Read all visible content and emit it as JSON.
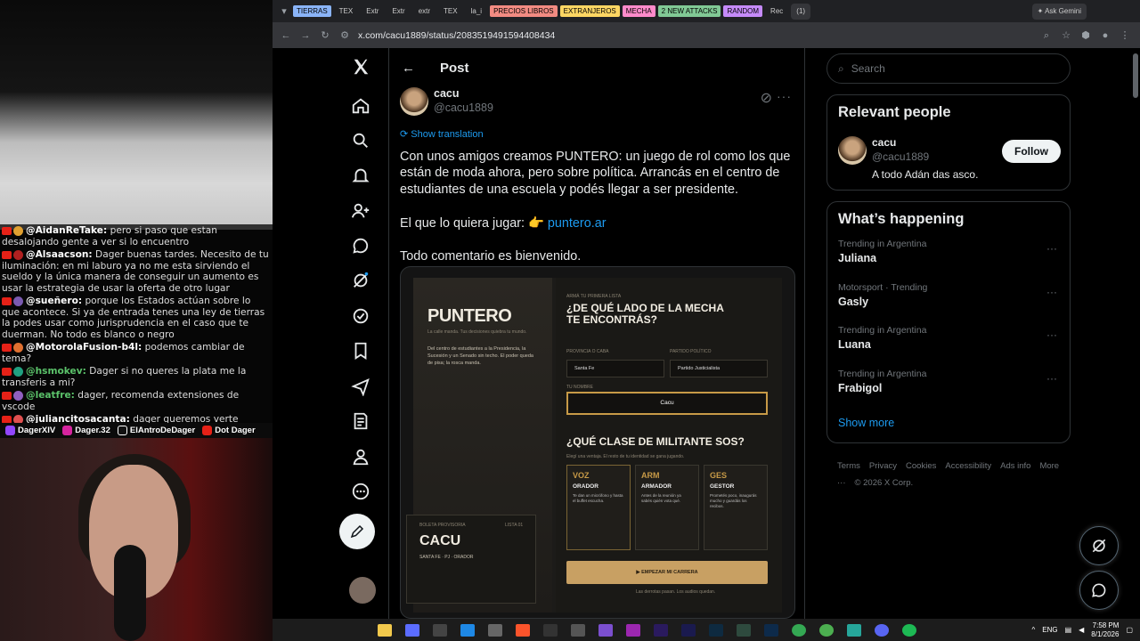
{
  "stream": {
    "chat": [
      {
        "user": "@AidanReTake:",
        "text": " pero si paso que estan desalojando gente a ver si lo encuentro",
        "color": "#e0a030"
      },
      {
        "user": "@Alsaacson:",
        "text": " Dager buenas tardes. Necesito de tu iluminación: en mi laburo ya no me esta sirviendo el sueldo y la única manera de conseguir un aumento es usar la estrategia de usar la oferta de otro lugar",
        "color": "#b02020"
      },
      {
        "user": "@sueñero:",
        "text": " porque los Estados actúan sobre lo que acontece. Si ya de entrada tenes una ley de tierras la podes usar como jurisprudencia en el caso que te duerman. No todo es blanco o negro",
        "color": "#7a5ab0"
      },
      {
        "user": "@MotorolaFusion-b4l:",
        "text": " podemos cambiar de tema?",
        "color": "#e07030"
      },
      {
        "user": "@hsmokev:",
        "text": " Dager si no queres la plata me la transferis a mi?",
        "color": "#20a080",
        "green": true
      },
      {
        "user": "@leatfre:",
        "text": " dager, recomenda extensiones de vscode",
        "color": "#9060c0",
        "green": true
      },
      {
        "user": "@juliancitosacanta:",
        "text": " dager queremos verte batear unos",
        "color": "#e05050"
      }
    ],
    "socials": [
      "DagerXIV",
      "Dager.32",
      "ElAntroDeDager",
      "Dot Dager"
    ]
  },
  "browser": {
    "tabs": [
      "TIERRAS",
      "TEX",
      "Extr",
      "Extr",
      "extr",
      "TEX",
      "la_i",
      "PRECIOS LIBROS",
      "EXTRANJEROS",
      "MECHA",
      "2 NEW ATTACKS",
      "RANDOM",
      "Rec",
      "(1)"
    ],
    "tag_colors": {
      "TIERRAS": "#8ab4f8",
      "PRECIOS LIBROS": "#f28b82",
      "EXTRANJEROS": "#fdd663",
      "MECHA": "#ff8bcb",
      "2 NEW ATTACKS": "#81c995",
      "RANDOM": "#c58af9"
    },
    "ask_gemini": "Ask Gemini",
    "url": "x.com/cacu1889/status/2083519491594408434"
  },
  "x": {
    "header_title": "Post",
    "author_name": "cacu",
    "author_handle": "@cacu1889",
    "show_translation": "Show translation",
    "post_paragraphs": [
      "Con unos amigos creamos PUNTERO: un juego de rol como los que están de moda ahora, pero sobre política. Arrancás en el centro de estudiantes de una escuela y podés llegar a ser presidente."
    ],
    "play_prefix": "El que lo quiera jugar: 👉",
    "play_link": "puntero.ar",
    "closing": "Todo comentario es bienvenido.",
    "game": {
      "logo": "PUNTERO",
      "tagline": "La calle manda. Tus decisiones quiebra tu mundo.",
      "left_intro": "Del centro de estudiantes a la Presidencia, la Sucesión y un Senado sin techo. El poder queda de pisa; la rosca manda.",
      "section_label": "ARMÁ TU PRIMERA LISTA",
      "question1": "¿DE QUÉ LADO DE LA MECHA TE ENCONTRÁS?",
      "province_label": "PROVINCIA O CABA",
      "party_label": "PARTIDO POLÍTICO",
      "province_value": "Santa Fe",
      "party_value": "Partido Justicialista",
      "name_label": "TU NOMBRE",
      "name_value": "Cacu",
      "question2": "¿QUÉ CLASE DE MILITANTE SOS?",
      "question2_sub": "Elegí una ventaja. El resto de tu identidad se gana jugando.",
      "roles": [
        {
          "key": "VOZ",
          "name": "ORADOR",
          "desc": "Te dan un micrófono y hasta el buffet escucha."
        },
        {
          "key": "ARM",
          "name": "ARMADOR",
          "desc": "Antes de la reunión ya sabés quién vota qué."
        },
        {
          "key": "GES",
          "name": "GESTOR",
          "desc": "Prometés poco, inaugurás mucho y guardás los recibos."
        }
      ],
      "start_button": "EMPEZAR MI CARRERA",
      "ballot_label": "BOLETA PROVISORIA",
      "ballot_list": "LISTA 01",
      "ballot_name": "CACU",
      "ballot_meta": "SANTA FE · PJ · ORADOR",
      "footer_note": "Las derrotas pasan. Los audios quedan."
    },
    "search_placeholder": "Search",
    "relevant_title": "Relevant people",
    "relevant_name": "cacu",
    "relevant_handle": "@cacu1889",
    "relevant_bio": "A todo Adán das asco.",
    "follow_label": "Follow",
    "happening_title": "What’s happening",
    "trends": [
      {
        "context": "Trending in Argentina",
        "topic": "Juliana"
      },
      {
        "context": "Motorsport · Trending",
        "topic": "Gasly"
      },
      {
        "context": "Trending in Argentina",
        "topic": "Luana"
      },
      {
        "context": "Trending in Argentina",
        "topic": "Frabigol"
      }
    ],
    "show_more": "Show more",
    "footer_links": [
      "Terms",
      "Privacy",
      "Cookies",
      "Accessibility",
      "Ads info",
      "More ···",
      "© 2026 X Corp."
    ]
  },
  "taskbar": {
    "lang": "ENG",
    "time": "7:58 PM",
    "date": "8/1/2026"
  }
}
